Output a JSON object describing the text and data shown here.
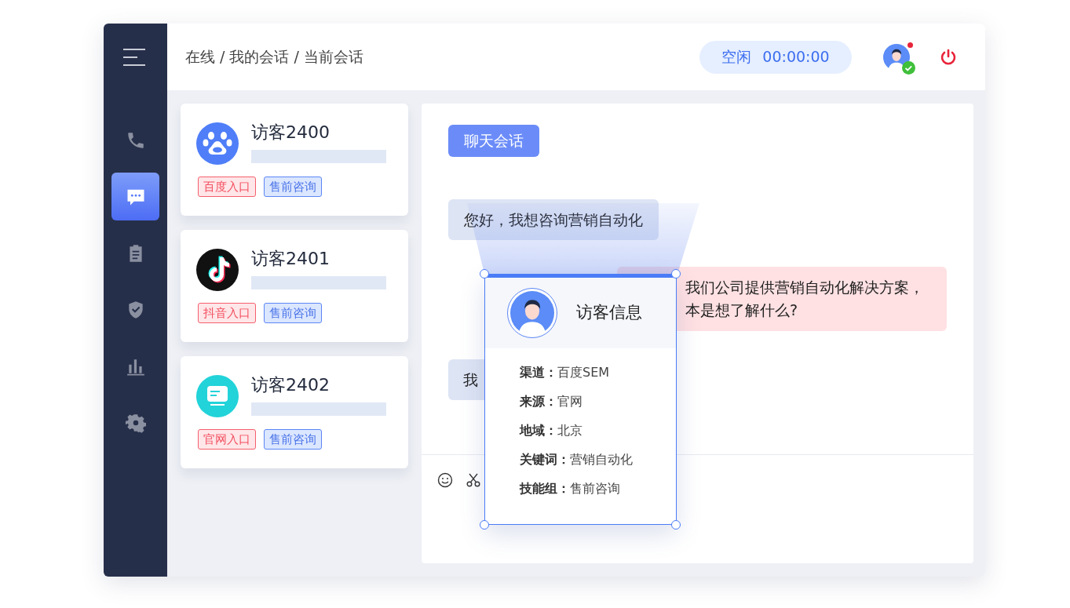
{
  "sidebar": {
    "items": [
      {
        "kind": "phone",
        "selected": false
      },
      {
        "kind": "chat",
        "selected": true
      },
      {
        "kind": "clipboard",
        "selected": false
      },
      {
        "kind": "shield",
        "selected": false
      },
      {
        "kind": "chart",
        "selected": false
      },
      {
        "kind": "gear",
        "selected": false
      }
    ]
  },
  "header": {
    "breadcrumb": "在线 / 我的会话 / 当前会话",
    "status": {
      "label": "空闲",
      "timer": "00:00:00"
    },
    "user": {
      "online": true,
      "notification": true
    }
  },
  "visitors": [
    {
      "name": "访客2400",
      "kind": "paw",
      "tags": [
        {
          "label": "百度入口",
          "kind": "source"
        },
        {
          "label": "售前咨询",
          "kind": "group"
        }
      ]
    },
    {
      "name": "访客2401",
      "kind": "note",
      "tags": [
        {
          "label": "抖音入口",
          "kind": "source"
        },
        {
          "label": "售前咨询",
          "kind": "group"
        }
      ]
    },
    {
      "name": "访客2402",
      "kind": "screen",
      "tags": [
        {
          "label": "官网入口",
          "kind": "source"
        },
        {
          "label": "售前咨询",
          "kind": "group"
        }
      ]
    }
  ],
  "chat": {
    "tab": "聊天会话",
    "messages": [
      {
        "kind": "visitor",
        "lines": [
          "您好，我想咨询营销自动化"
        ]
      },
      {
        "kind": "agent",
        "lines": [
          "我们公司提供营销自动化解决方案，",
          "本是想了解什么?"
        ]
      },
      {
        "kind": "visitor",
        "lines": [
          "我"
        ]
      }
    ]
  },
  "visitor_info": {
    "title": "访客信息",
    "fields": [
      {
        "label": "渠道：",
        "value": "百度SEM"
      },
      {
        "label": "来源：",
        "value": "官网"
      },
      {
        "label": "地域：",
        "value": "北京"
      },
      {
        "label": "关键词：",
        "value": "营销自动化"
      },
      {
        "label": "技能组：",
        "value": "售前咨询"
      }
    ]
  }
}
